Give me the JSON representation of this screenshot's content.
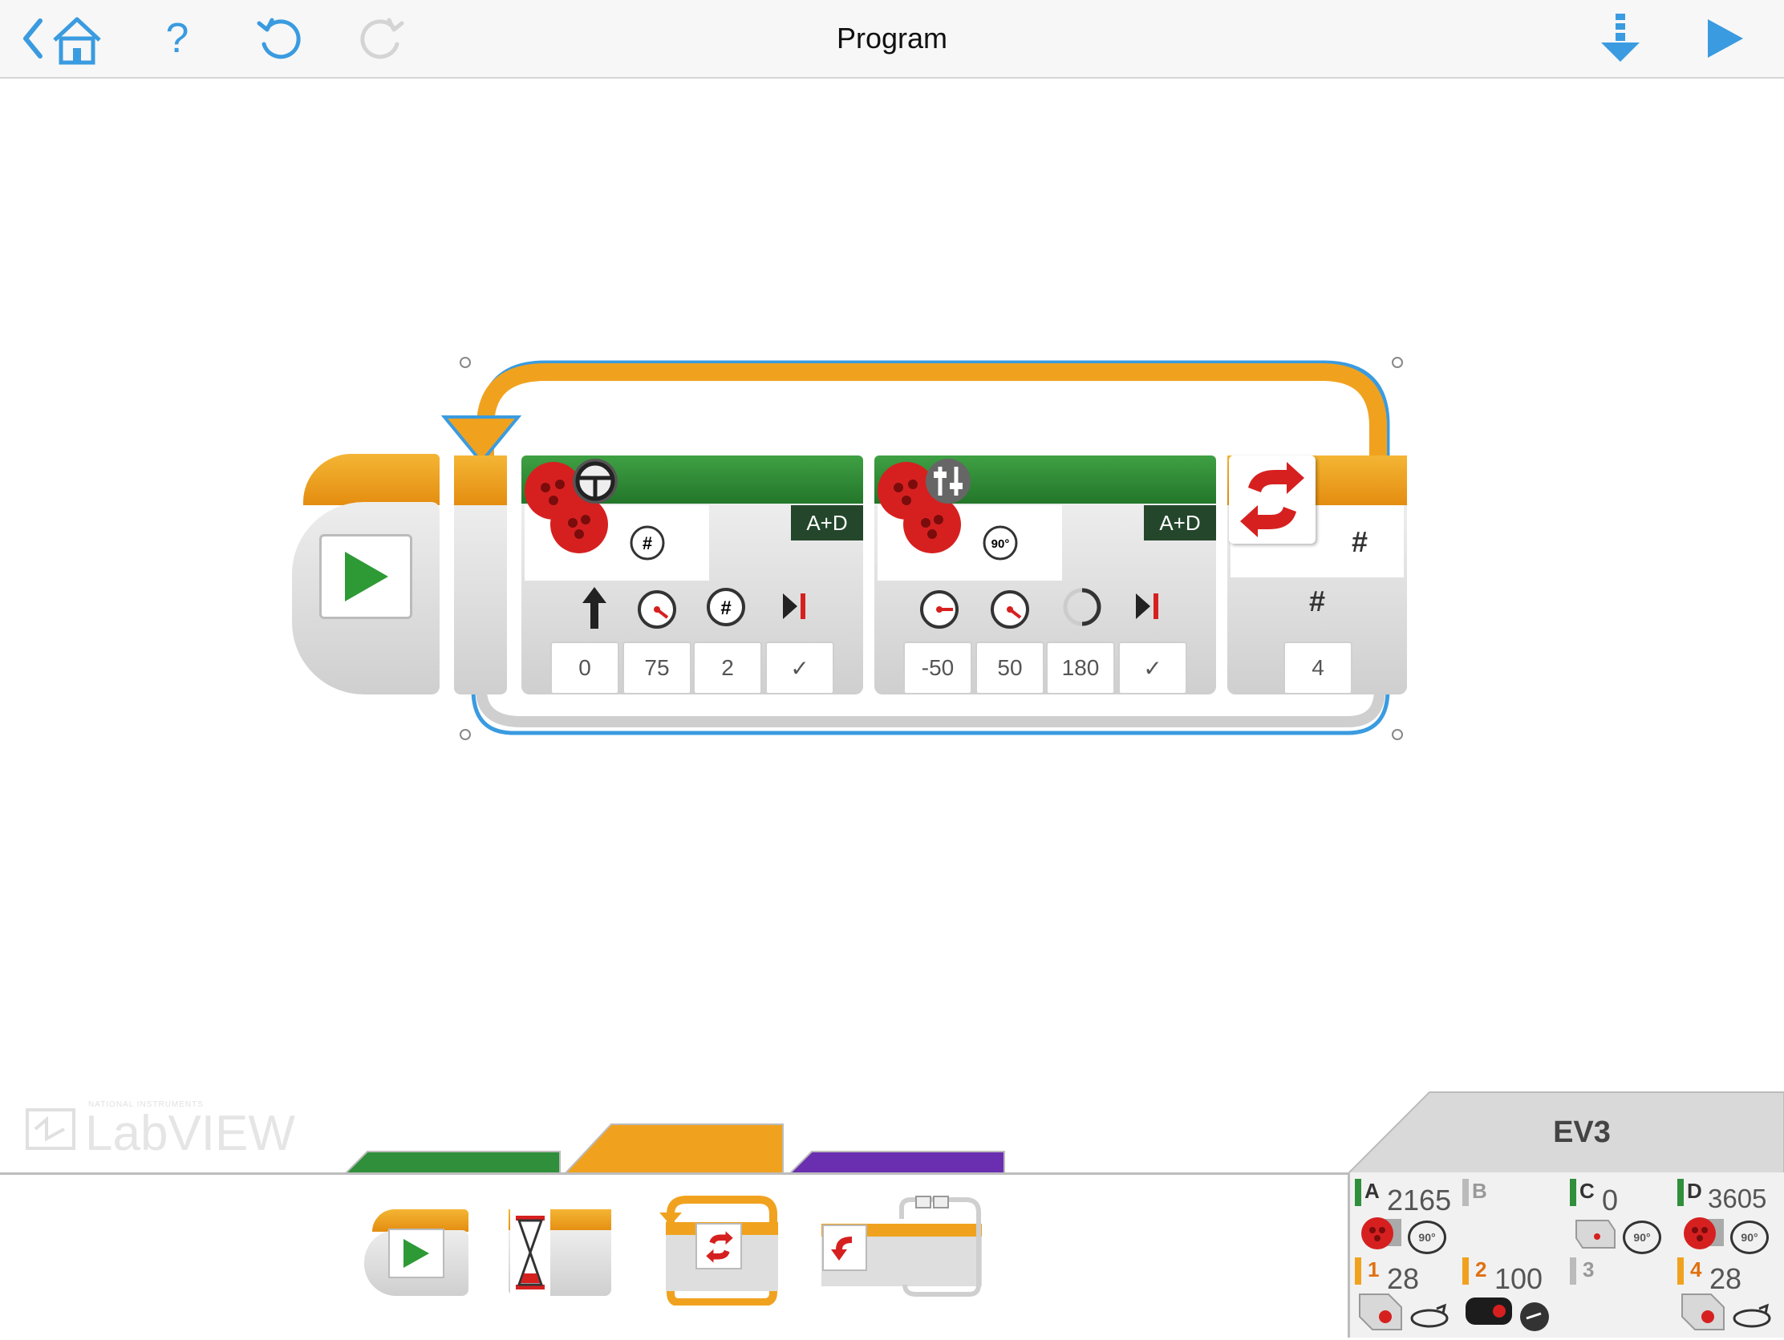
{
  "topbar": {
    "title": "Program",
    "back_icon": "chevron-left-icon",
    "home_icon": "home-icon",
    "help_label": "?",
    "undo_icon": "undo-icon",
    "redo_icon": "redo-icon",
    "download_icon": "download-icon",
    "run_icon": "play-icon",
    "accent": "#3a9be0"
  },
  "program": {
    "start_block": {
      "icon": "play-icon"
    },
    "steering_block": {
      "port": "A+D",
      "mode_icon": "rotations-icon",
      "params": [
        {
          "icon": "steering-arrow-icon",
          "value": "0"
        },
        {
          "icon": "speed-dial-icon",
          "value": "75"
        },
        {
          "icon": "rotations-icon",
          "value": "2"
        },
        {
          "icon": "brake-at-end-icon",
          "value": "✓"
        }
      ]
    },
    "tank_block": {
      "port": "A+D",
      "mode_icon": "degrees-icon",
      "params": [
        {
          "icon": "speed-dial-left-icon",
          "value": "-50"
        },
        {
          "icon": "speed-dial-right-icon",
          "value": "50"
        },
        {
          "icon": "degrees-circle-icon",
          "value": "180"
        },
        {
          "icon": "brake-at-end-icon",
          "value": "✓"
        }
      ]
    },
    "loop_end": {
      "mode_symbol": "#",
      "param_symbol": "#",
      "count": "4"
    }
  },
  "watermark": {
    "brand": "LabVIEW",
    "small": "NATIONAL INSTRUMENTS"
  },
  "palette": {
    "tabs": [
      {
        "name": "action",
        "color": "#2f8f3a"
      },
      {
        "name": "flow",
        "color": "#f0a21f"
      },
      {
        "name": "data",
        "color": "#6a2fb0"
      }
    ],
    "items": [
      {
        "name": "start-block",
        "icon": "play-icon"
      },
      {
        "name": "wait-block",
        "icon": "hourglass-icon"
      },
      {
        "name": "loop-block",
        "icon": "loop-icon"
      },
      {
        "name": "switch-block",
        "icon": "switch-icon"
      }
    ]
  },
  "ev3": {
    "title": "EV3",
    "ports": [
      {
        "port": "A",
        "value": "2165",
        "device": "large-motor-icon",
        "mode": "90°"
      },
      {
        "port": "B",
        "value": "",
        "device": "",
        "mode": ""
      },
      {
        "port": "C",
        "value": "0",
        "device": "medium-motor-icon",
        "mode": "90°"
      },
      {
        "port": "D",
        "value": "3605",
        "device": "large-motor-icon",
        "mode": "90°"
      },
      {
        "port": "1",
        "value": "28",
        "device": "gyro-sensor-icon",
        "mode": ""
      },
      {
        "port": "2",
        "value": "100",
        "device": "color-sensor-icon",
        "mode": ""
      },
      {
        "port": "3",
        "value": "",
        "device": "",
        "mode": ""
      },
      {
        "port": "4",
        "value": "28",
        "device": "gyro-sensor-icon",
        "mode": ""
      }
    ]
  }
}
